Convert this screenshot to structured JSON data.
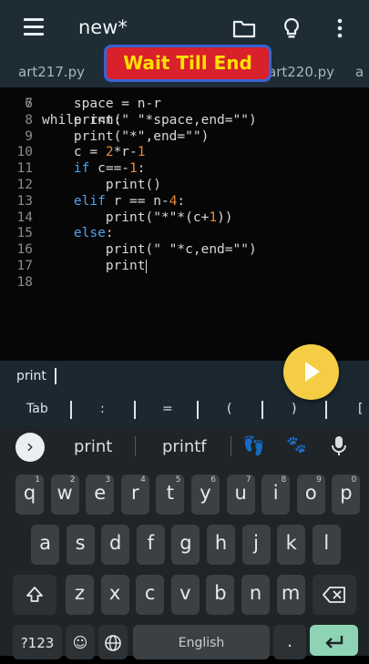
{
  "appbar": {
    "title": "new*",
    "icons": [
      "menu-icon",
      "folder-icon",
      "lightbulb-icon",
      "more-vert-icon"
    ]
  },
  "tabs": [
    "art217.py",
    "a",
    "art220.py",
    "a"
  ],
  "banner": "Wait Till End",
  "editor": {
    "partial_top_line": "while r<n:",
    "lines": [
      {
        "n": "7",
        "code": "    space = n-r"
      },
      {
        "n": "8",
        "code": "    print(\" \"*space,end=\"\")"
      },
      {
        "n": "9",
        "code": "    print(\"*\",end=\"\")"
      },
      {
        "n": "10",
        "code": "    c = 2*r-1"
      },
      {
        "n": "11",
        "code": "    if c==-1:"
      },
      {
        "n": "12",
        "code": "        print()"
      },
      {
        "n": "13",
        "code": "    elif r == n-4:"
      },
      {
        "n": "14",
        "code": "        print(\"*\"*(c+1))"
      },
      {
        "n": "15",
        "code": "    else:"
      },
      {
        "n": "16",
        "code": "        print(\" \"*c,end=\"\")"
      },
      {
        "n": "17",
        "code": "        print"
      },
      {
        "n": "18",
        "code": ""
      }
    ]
  },
  "command_bar": {
    "text": "print"
  },
  "extra_keys": [
    "Tab",
    ":",
    "=",
    "(",
    ")",
    "["
  ],
  "keyboard": {
    "suggestions": [
      "print",
      "printf"
    ],
    "emoji_suggestions": [
      "👣",
      "🐾"
    ],
    "row1": [
      [
        "q",
        "1"
      ],
      [
        "w",
        "2"
      ],
      [
        "e",
        "3"
      ],
      [
        "r",
        "4"
      ],
      [
        "t",
        "5"
      ],
      [
        "y",
        "6"
      ],
      [
        "u",
        "7"
      ],
      [
        "i",
        "8"
      ],
      [
        "o",
        "9"
      ],
      [
        "p",
        "0"
      ]
    ],
    "row2": [
      "a",
      "s",
      "d",
      "f",
      "g",
      "h",
      "j",
      "k",
      "l"
    ],
    "row3": [
      "z",
      "x",
      "c",
      "v",
      "b",
      "n",
      "m"
    ],
    "bottom": {
      "symbols": "?123",
      "space": "English"
    }
  },
  "colors": {
    "appbar": "#1d2c35",
    "accent_fab": "#f5cd45",
    "banner_bg": "#d8212b",
    "banner_text": "#ffe000",
    "keyword": "#4da3f0",
    "number": "#e88a3b",
    "enter": "#8fd3b5"
  }
}
